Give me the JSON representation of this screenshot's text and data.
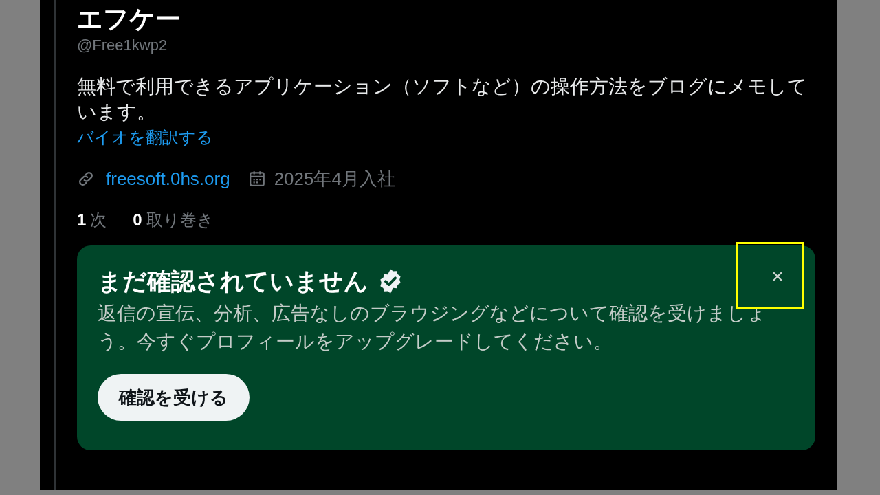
{
  "profile": {
    "display_name": "エフケー",
    "handle": "@Free1kwp2",
    "bio": "無料で利用できるアプリケーション（ソフトなど）の操作方法をブログにメモしています。",
    "translate_link": "バイオを翻訳する",
    "website": "freesoft.0hs.org",
    "joined": "2025年4月入社"
  },
  "stats": [
    {
      "count": "1",
      "label": "次"
    },
    {
      "count": "0",
      "label": "取り巻き"
    }
  ],
  "verify_card": {
    "title": "まだ確認されていません",
    "body": "返信の宣伝、分析、広告なしのブラウジングなどについて確認を受けましょう。今すぐプロフィールをアップグレードしてください。",
    "button": "確認を受ける",
    "close": "×",
    "close_highlighted": true
  }
}
